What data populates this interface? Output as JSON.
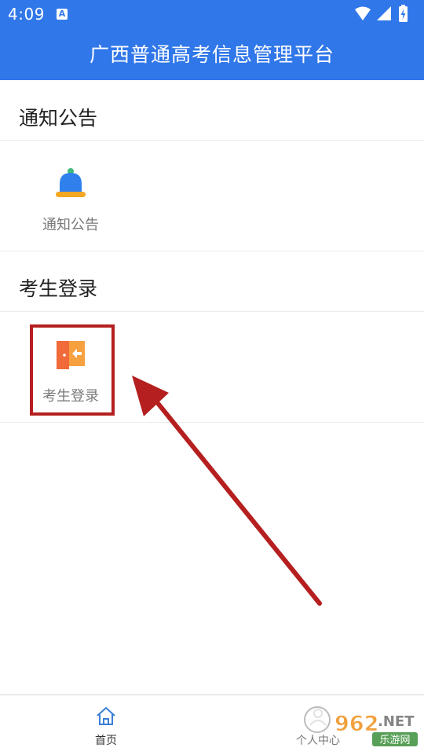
{
  "status_bar": {
    "time": "4:09",
    "notification_badge": "A",
    "icons": [
      "wifi-icon",
      "signal-icon",
      "battery-charging-icon"
    ]
  },
  "header": {
    "title": "广西普通高考信息管理平台",
    "background": "#3077e9"
  },
  "sections": [
    {
      "title": "通知公告",
      "tiles": [
        {
          "label": "通知公告",
          "icon": "bell-icon"
        }
      ]
    },
    {
      "title": "考生登录",
      "tiles": [
        {
          "label": "考生登录",
          "icon": "login-door-icon"
        }
      ]
    }
  ],
  "annotation": {
    "color": "#b51f1f"
  },
  "bottom_nav": {
    "items": [
      {
        "label": "首页",
        "icon": "home-icon",
        "active": true
      },
      {
        "label": "个人中心",
        "icon": "user-icon",
        "active": false
      }
    ]
  },
  "watermark": {
    "text": "962.NET",
    "sub": "乐游网"
  }
}
